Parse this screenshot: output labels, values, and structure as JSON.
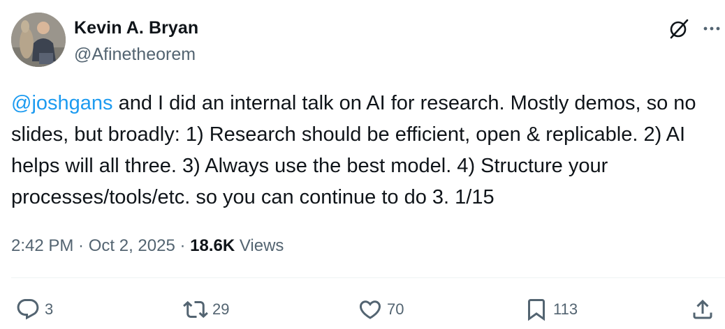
{
  "author": {
    "display_name": "Kevin A. Bryan",
    "handle": "@Afinetheorem",
    "avatar_icon": "profile-photo"
  },
  "header_actions": {
    "grok_icon": "grok-icon",
    "more_icon": "more-horizontal-icon"
  },
  "tweet": {
    "mention": "@joshgans",
    "text": " and I did an internal talk on AI for research. Mostly demos, so no slides, but broadly: 1) Research should be efficient, open & replicable. 2) AI helps will all three. 3) Always use the best model. 4) Structure your processes/tools/etc. so you can continue to do 3. 1/15"
  },
  "meta": {
    "time": "2:42 PM",
    "separator1": " · ",
    "date": "Oct 2, 2025",
    "separator2": " · ",
    "views_count": "18.6K",
    "views_label": " Views"
  },
  "actions": {
    "reply": {
      "icon": "reply-icon",
      "count": "3"
    },
    "repost": {
      "icon": "repost-icon",
      "count": "29"
    },
    "like": {
      "icon": "heart-icon",
      "count": "70"
    },
    "bookmark": {
      "icon": "bookmark-icon",
      "count": "113"
    },
    "share": {
      "icon": "share-icon"
    }
  },
  "colors": {
    "text": "#0f1419",
    "secondary": "#536471",
    "link": "#1d9bf0",
    "divider": "#eff3f4"
  }
}
